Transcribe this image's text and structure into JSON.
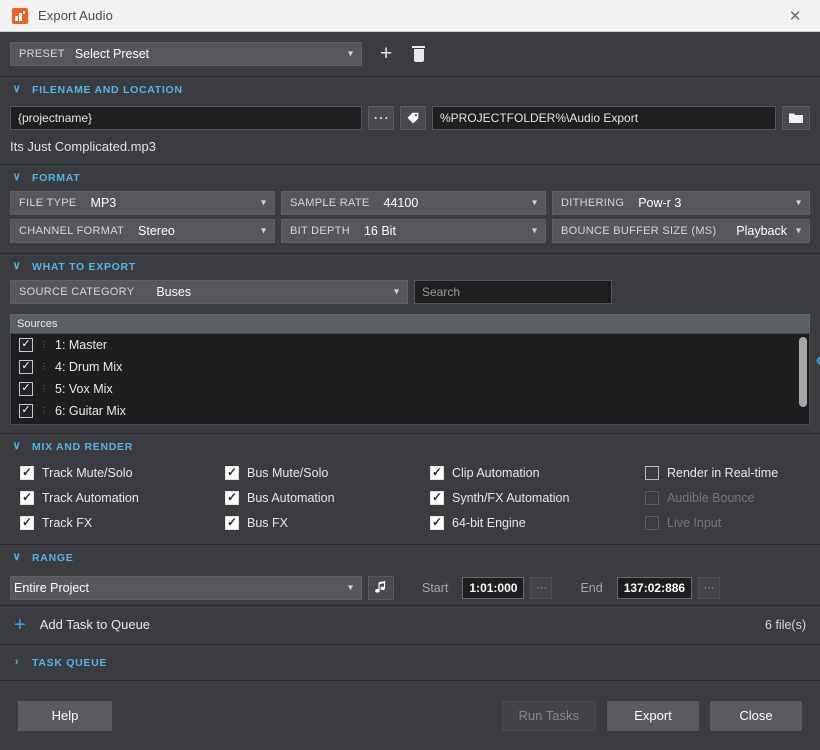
{
  "window": {
    "title": "Export Audio",
    "app_icon": "bar-chart-icon",
    "close_label": "✕",
    "accent_color": "#57b4e8",
    "brand_color": "#e8622a"
  },
  "preset": {
    "label": "PRESET",
    "value": "Select Preset",
    "add_label": "+",
    "delete_icon": "trash-icon"
  },
  "filename_section": {
    "header": "FILENAME AND LOCATION",
    "chevron": "∨",
    "name_value": "{projectname}",
    "browse_icon": "ellipsis-icon",
    "tag_icon": "tag-icon",
    "path_value": "%PROJECTFOLDER%\\Audio Export",
    "folder_icon": "folder-icon",
    "preview": "Its Just Complicated.mp3"
  },
  "format_section": {
    "header": "FORMAT",
    "chevron": "∨",
    "fields": [
      {
        "label": "FILE TYPE",
        "value": "MP3"
      },
      {
        "label": "SAMPLE RATE",
        "value": "44100"
      },
      {
        "label": "DITHERING",
        "value": "Pow-r 3"
      },
      {
        "label": "CHANNEL FORMAT",
        "value": "Stereo"
      },
      {
        "label": "BIT DEPTH",
        "value": "16 Bit"
      },
      {
        "label": "BOUNCE BUFFER SIZE (MS)",
        "value": "Playback"
      }
    ]
  },
  "what_to_export": {
    "header": "WHAT TO EXPORT",
    "chevron": "∨",
    "source_category_label": "SOURCE CATEGORY",
    "source_category_value": "Buses",
    "search_placeholder": "Search",
    "search_value": "",
    "sources_column_header": "Sources",
    "expand_icon": "chevron-left-icon",
    "sources": [
      {
        "label": "1: Master",
        "checked": true
      },
      {
        "label": "4: Drum Mix",
        "checked": true
      },
      {
        "label": "5: Vox Mix",
        "checked": true
      },
      {
        "label": "6: Guitar Mix",
        "checked": true
      }
    ]
  },
  "mix_and_render": {
    "header": "MIX AND RENDER",
    "chevron": "∨",
    "options": [
      {
        "label": "Track Mute/Solo",
        "checked": true,
        "disabled": false
      },
      {
        "label": "Bus Mute/Solo",
        "checked": true,
        "disabled": false
      },
      {
        "label": "Clip Automation",
        "checked": true,
        "disabled": false
      },
      {
        "label": "Render in Real-time",
        "checked": false,
        "disabled": false
      },
      {
        "label": "Track Automation",
        "checked": true,
        "disabled": false
      },
      {
        "label": "Bus Automation",
        "checked": true,
        "disabled": false
      },
      {
        "label": "Synth/FX Automation",
        "checked": true,
        "disabled": false
      },
      {
        "label": "Audible Bounce",
        "checked": false,
        "disabled": true
      },
      {
        "label": "Track FX",
        "checked": true,
        "disabled": false
      },
      {
        "label": "Bus FX",
        "checked": true,
        "disabled": false
      },
      {
        "label": "64-bit Engine",
        "checked": true,
        "disabled": false
      },
      {
        "label": "Live Input",
        "checked": false,
        "disabled": true
      }
    ]
  },
  "range_section": {
    "header": "RANGE",
    "chevron": "∨",
    "range_value": "Entire Project",
    "music_icon": "music-note-icon",
    "start_label": "Start",
    "start_value": "1:01:000",
    "end_label": "End",
    "end_value": "137:02:886",
    "more_icon": "ellipsis-icon"
  },
  "add_task": {
    "plus": "+",
    "label": "Add Task to Queue",
    "file_count": "6 file(s)"
  },
  "task_queue": {
    "header": "TASK QUEUE",
    "chevron": "›"
  },
  "footer": {
    "help_label": "Help",
    "run_tasks_label": "Run Tasks",
    "export_label": "Export",
    "close_label": "Close"
  }
}
